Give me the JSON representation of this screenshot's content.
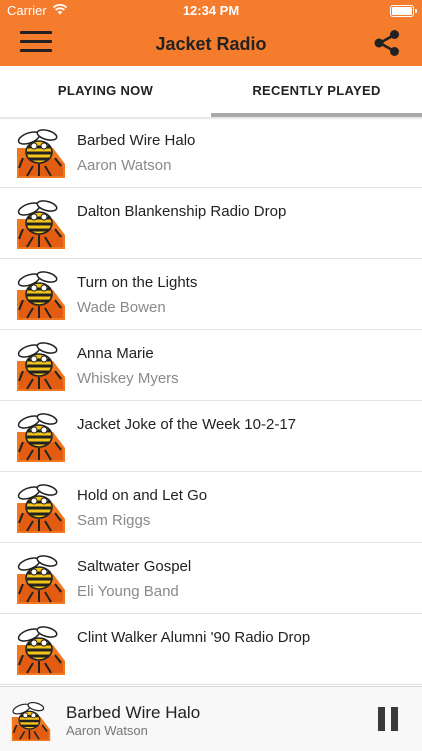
{
  "status": {
    "carrier": "Carrier",
    "time": "12:34 PM"
  },
  "appbar": {
    "title": "Jacket Radio",
    "menu_icon": "hamburger-menu-icon",
    "share_icon": "share-icon",
    "color": "#f47c2c"
  },
  "tabs": [
    {
      "label": "PLAYING NOW",
      "active": false
    },
    {
      "label": "RECENTLY PLAYED",
      "active": true
    }
  ],
  "recently_played": [
    {
      "title": "Barbed Wire Halo",
      "artist": "Aaron Watson"
    },
    {
      "title": "Dalton Blankenship Radio Drop",
      "artist": ""
    },
    {
      "title": "Turn on the Lights",
      "artist": "Wade Bowen"
    },
    {
      "title": "Anna Marie",
      "artist": "Whiskey Myers"
    },
    {
      "title": "Jacket Joke of the Week 10-2-17",
      "artist": ""
    },
    {
      "title": "Hold on and Let Go",
      "artist": "Sam Riggs"
    },
    {
      "title": "Saltwater Gospel",
      "artist": "Eli Young Band"
    },
    {
      "title": "Clint Walker Alumni '90 Radio Drop",
      "artist": ""
    }
  ],
  "now_playing": {
    "title": "Barbed Wire Halo",
    "artist": "Aaron Watson",
    "state": "playing"
  }
}
